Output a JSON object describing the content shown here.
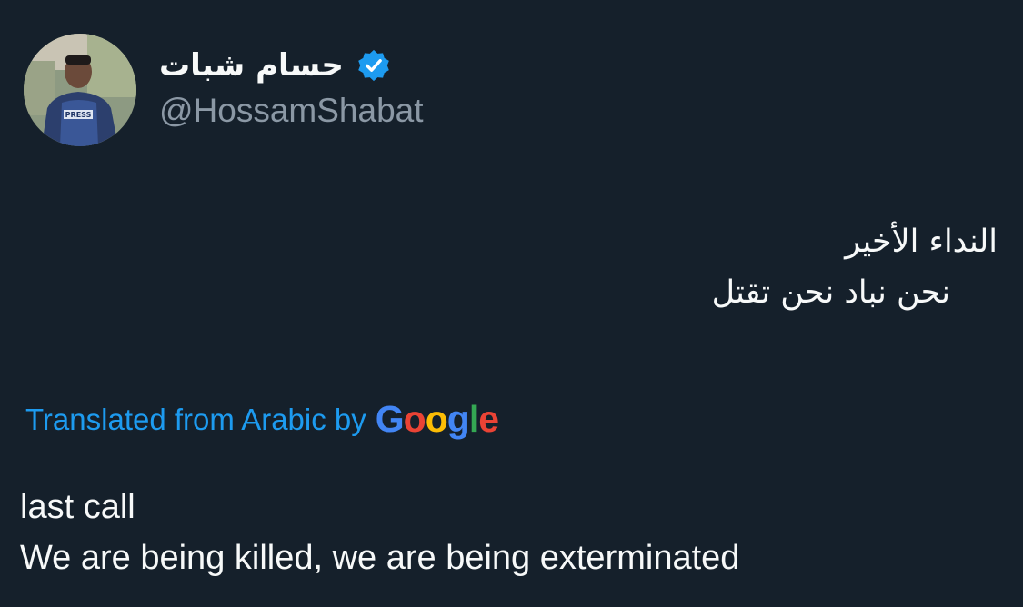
{
  "author": {
    "display_name": "حسام شبات",
    "handle": "@HossamShabat",
    "verified": true,
    "avatar_vest_text": "PRESS"
  },
  "tweet": {
    "original_lines": [
      "النداء الأخير",
      "نحن نباد نحن تقتل"
    ],
    "translation_label": "Translated from Arabic by",
    "translation_provider": "Google",
    "translated_lines": [
      "last call",
      "We are being killed, we are being exterminated"
    ]
  },
  "colors": {
    "background": "#15202b",
    "accent": "#1d9bf0",
    "secondary_text": "#8b98a5",
    "google_blue": "#4285f4",
    "google_red": "#ea4335",
    "google_yellow": "#fbbc05",
    "google_green": "#34a853"
  },
  "icons": {
    "verified": "verified-badge-icon",
    "avatar": "profile-photo"
  }
}
